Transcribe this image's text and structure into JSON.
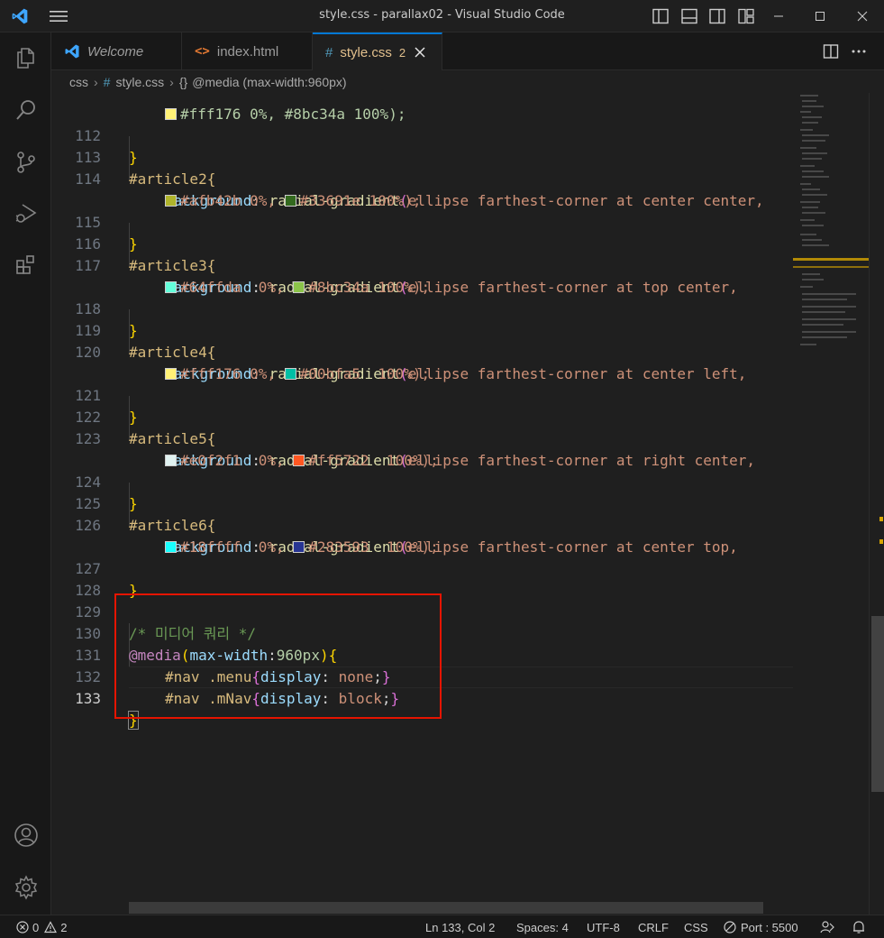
{
  "titlebar": {
    "title": "style.css - parallax02 - Visual Studio Code",
    "icons": [
      "vscode-logo-icon",
      "menu-icon",
      "toggle-primary-sidebar-icon",
      "toggle-panel-icon",
      "toggle-secondary-sidebar-icon",
      "customize-layout-icon",
      "minimize-icon",
      "maximize-icon",
      "close-icon"
    ]
  },
  "activity_bar": {
    "items": [
      "explorer-icon",
      "search-icon",
      "source-control-icon",
      "run-debug-icon",
      "extensions-icon"
    ],
    "bottom": [
      "accounts-icon",
      "manage-icon"
    ]
  },
  "tabs": [
    {
      "label": "Welcome",
      "icon": "vscode-icon",
      "italic": true
    },
    {
      "label": "index.html",
      "icon": "html-icon"
    },
    {
      "label": "style.css",
      "icon": "css-hash-icon",
      "badge": "2",
      "active": true
    }
  ],
  "breadcrumb": {
    "items": [
      "css",
      "style.css",
      "@media (max-width:960px)"
    ]
  },
  "code": {
    "line_numbers": [
      "112",
      "113",
      "114",
      "115",
      "116",
      "117",
      "118",
      "119",
      "120",
      "121",
      "122",
      "123",
      "124",
      "125",
      "126",
      "127",
      "128",
      "129",
      "130",
      "131",
      "132",
      "133"
    ],
    "partial_top": "#fff176 0%, #8bc34a 100%);",
    "l112": "}",
    "l113": "#article2{",
    "l114_prop": "background",
    "l114_fn": "radial-gradient",
    "l114_args": "ellipse farthest-corner at center center,",
    "l114w": "#afb42b 0%, ",
    "l114w2": "#33691e 100%);",
    "l115": "}",
    "l116": "#article3{",
    "l117_args": "ellipse farthest-corner at top center,",
    "l117w": "#64ffda  0%, ",
    "l117w2": "#8bc34a 100%);",
    "l118": "}",
    "l119": "#article4{",
    "l120_args": "ellipse farthest-corner at center left,",
    "l120w": "#fff176 0%, ",
    "l120w2": "#00bfa5  100%);",
    "l121": "}",
    "l122": "#article5{",
    "l123_args": "ellipse farthest-corner at right center,",
    "l123w": "#e0f2f1  0%, ",
    "l123w2": "#ff5722  100%);",
    "l124": "}",
    "l125": "#article6{",
    "l126_args": "ellipse farthest-corner at center top,",
    "l126w": "#18ffff  0%, ",
    "l126w2": "#283593  100%);",
    "l127": "}",
    "l129": "/* 미디어 쿼리 */",
    "l130_at": "@media",
    "l130_prop": "max-width",
    "l130_val": "960px",
    "l131_sel": "#nav .menu",
    "l131_prop": "display",
    "l131_val": "none",
    "l132_sel": "#nav .mNav",
    "l132_prop": "display",
    "l132_val": "block",
    "l133": "}"
  },
  "swatch_colors": {
    "afb42b": "#afb42b",
    "33691e": "#33691e",
    "64ffda": "#64ffda",
    "8bc34a": "#8bc34a",
    "fff176": "#fff176",
    "00bfa5": "#00bfa5",
    "e0f2f1": "#e0f2f1",
    "ff5722": "#ff5722",
    "18ffff": "#18ffff",
    "283593": "#283593"
  },
  "status_bar": {
    "errors": "0",
    "warnings": "2",
    "position": "Ln 133, Col 2",
    "spaces": "Spaces: 4",
    "encoding": "UTF-8",
    "eol": "CRLF",
    "language": "CSS",
    "port": "Port : 5500"
  }
}
